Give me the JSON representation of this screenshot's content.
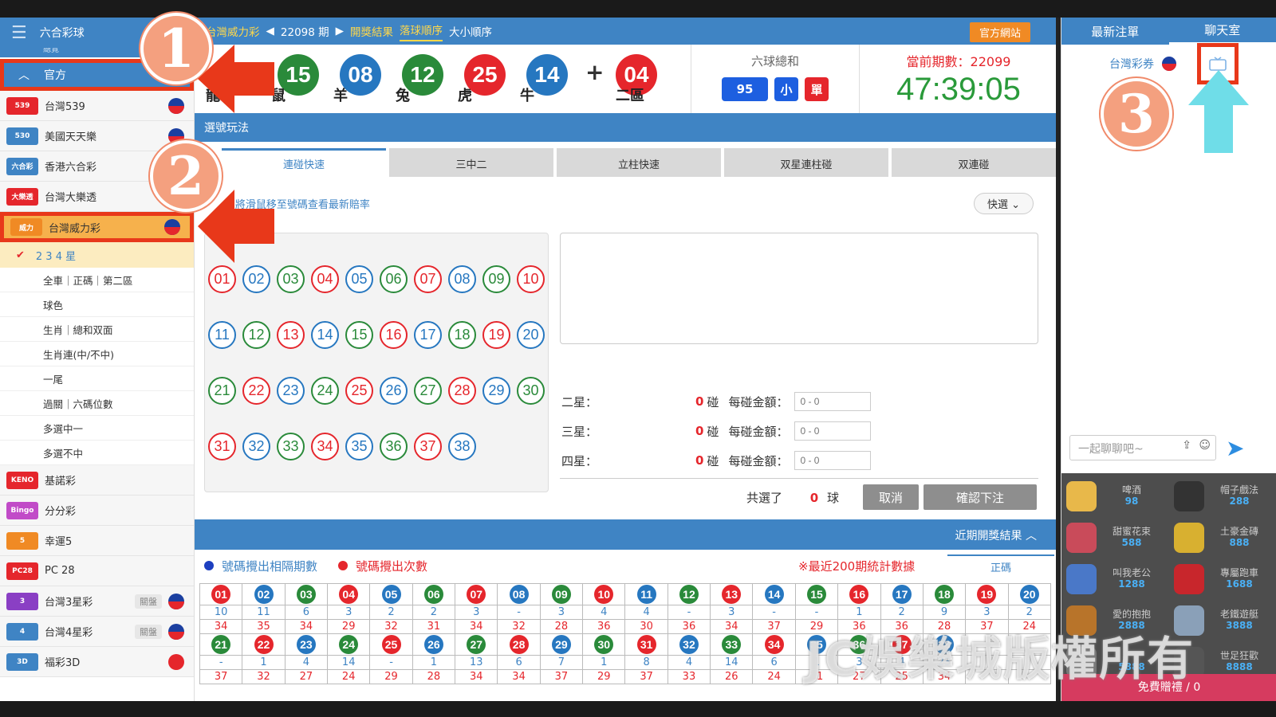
{
  "sidebar": {
    "title": "六合彩球",
    "sub": "總覽",
    "official": "官方",
    "games_top": [
      {
        "name": "台灣539",
        "logo": "539",
        "color": "#e5262c",
        "flag": "tw"
      },
      {
        "name": "美國天天樂",
        "logo": "530",
        "color": "#3f84c4",
        "flag": "tw"
      },
      {
        "name": "香港六合彩",
        "logo": "六合彩",
        "color": "#3f84c4",
        "flag": ""
      },
      {
        "name": "台灣大樂透",
        "logo": "大樂透",
        "color": "#e5262c",
        "flag": ""
      }
    ],
    "active_game": "台灣威力彩",
    "selected_play": "2 3 4 星",
    "sub_items": [
      "全車｜正碼｜第二區",
      "球色",
      "生肖｜總和双面",
      "生肖連(中/不中)",
      "一尾",
      "過關｜六碼位數",
      "多選中一",
      "多選不中"
    ],
    "games_bottom": [
      {
        "name": "基諾彩",
        "logo": "KENO",
        "color": "#e5262c",
        "badge": "",
        "flag": ""
      },
      {
        "name": "分分彩",
        "logo": "Bingo",
        "color": "#c14bc8",
        "badge": "",
        "flag": ""
      },
      {
        "name": "幸運5",
        "logo": "5",
        "color": "#f08a24",
        "badge": "",
        "flag": ""
      },
      {
        "name": "PC 28",
        "logo": "PC28",
        "color": "#e5262c",
        "badge": "",
        "flag": ""
      },
      {
        "name": "台灣3星彩",
        "logo": "3",
        "color": "#8a3fc4",
        "badge": "關盤",
        "flag": "tw"
      },
      {
        "name": "台灣4星彩",
        "logo": "4",
        "color": "#3f84c4",
        "badge": "關盤",
        "flag": "tw"
      },
      {
        "name": "福彩3D",
        "logo": "3D",
        "color": "#3f84c4",
        "badge": "",
        "flag": "cn"
      }
    ]
  },
  "nav": {
    "game": "台灣威力彩",
    "period": "22098 期",
    "results": "開獎結果",
    "drop_order": "落球順序",
    "size_order": "大小順序",
    "official_site": "官方網站"
  },
  "draw": {
    "balls": [
      {
        "num": "15",
        "label": "鼠",
        "color": "#2a8a3a"
      },
      {
        "num": "08",
        "label": "羊",
        "color": "#2677c0"
      },
      {
        "num": "12",
        "label": "兔",
        "color": "#2a8a3a"
      },
      {
        "num": "25",
        "label": "虎",
        "color": "#e5262c"
      },
      {
        "num": "14",
        "label": "牛",
        "color": "#2677c0"
      }
    ],
    "first_label": "龍",
    "special": {
      "num": "04",
      "label": "二區",
      "color": "#e5262c"
    },
    "sum_title": "六球總和",
    "sum_value": "95",
    "sum_size": "小",
    "sum_parity": "單",
    "period_label": "當前期數：22099",
    "countdown": "47:39:05"
  },
  "play": {
    "section_title": "選號玩法",
    "tabs": [
      "連碰快速",
      "三中二",
      "立柱快速",
      "双星連柱碰",
      "双連碰"
    ],
    "hint": "※將滑鼠移至號碼查看最新賠率",
    "quick_select": "快選",
    "numbers": [
      {
        "n": "01",
        "c": "r"
      },
      {
        "n": "02",
        "c": "b"
      },
      {
        "n": "03",
        "c": "g"
      },
      {
        "n": "04",
        "c": "r"
      },
      {
        "n": "05",
        "c": "b"
      },
      {
        "n": "06",
        "c": "g"
      },
      {
        "n": "07",
        "c": "r"
      },
      {
        "n": "08",
        "c": "b"
      },
      {
        "n": "09",
        "c": "g"
      },
      {
        "n": "10",
        "c": "r"
      },
      {
        "n": "11",
        "c": "b"
      },
      {
        "n": "12",
        "c": "g"
      },
      {
        "n": "13",
        "c": "r"
      },
      {
        "n": "14",
        "c": "b"
      },
      {
        "n": "15",
        "c": "g"
      },
      {
        "n": "16",
        "c": "r"
      },
      {
        "n": "17",
        "c": "b"
      },
      {
        "n": "18",
        "c": "g"
      },
      {
        "n": "19",
        "c": "r"
      },
      {
        "n": "20",
        "c": "b"
      },
      {
        "n": "21",
        "c": "g"
      },
      {
        "n": "22",
        "c": "r"
      },
      {
        "n": "23",
        "c": "b"
      },
      {
        "n": "24",
        "c": "g"
      },
      {
        "n": "25",
        "c": "r"
      },
      {
        "n": "26",
        "c": "b"
      },
      {
        "n": "27",
        "c": "g"
      },
      {
        "n": "28",
        "c": "r"
      },
      {
        "n": "29",
        "c": "b"
      },
      {
        "n": "30",
        "c": "g"
      },
      {
        "n": "31",
        "c": "r"
      },
      {
        "n": "32",
        "c": "b"
      },
      {
        "n": "33",
        "c": "g"
      },
      {
        "n": "34",
        "c": "r"
      },
      {
        "n": "35",
        "c": "b"
      },
      {
        "n": "36",
        "c": "g"
      },
      {
        "n": "37",
        "c": "r"
      },
      {
        "n": "38",
        "c": "b"
      }
    ],
    "bets": [
      {
        "label": "二星：",
        "count": "0",
        "unit": "碰",
        "amount_label": "每碰金額：",
        "placeholder": "0 - 0"
      },
      {
        "label": "三星：",
        "count": "0",
        "unit": "碰",
        "amount_label": "每碰金額：",
        "placeholder": "0 - 0"
      },
      {
        "label": "四星：",
        "count": "0",
        "unit": "碰",
        "amount_label": "每碰金額：",
        "placeholder": "0 - 0"
      }
    ],
    "selected_prefix": "共選了",
    "selected_count": "0",
    "selected_unit": "球",
    "cancel": "取消",
    "confirm": "確認下注"
  },
  "recent": {
    "title": "近期開獎結果",
    "legend_blue": "號碼攪出相隔期數",
    "legend_red": "號碼攪出次數",
    "note": "※最近200期統計數據",
    "tab": "正碼",
    "rows": [
      {
        "balls": [
          [
            "01",
            "r"
          ],
          [
            "02",
            "b"
          ],
          [
            "03",
            "g"
          ],
          [
            "04",
            "r"
          ],
          [
            "05",
            "b"
          ],
          [
            "06",
            "g"
          ],
          [
            "07",
            "r"
          ],
          [
            "08",
            "b"
          ],
          [
            "09",
            "g"
          ],
          [
            "10",
            "r"
          ],
          [
            "11",
            "b"
          ],
          [
            "12",
            "g"
          ],
          [
            "13",
            "r"
          ],
          [
            "14",
            "b"
          ],
          [
            "15",
            "g"
          ],
          [
            "16",
            "r"
          ],
          [
            "17",
            "b"
          ],
          [
            "18",
            "g"
          ],
          [
            "19",
            "r"
          ],
          [
            "20",
            "b"
          ]
        ],
        "gap": [
          "10",
          "11",
          "6",
          "3",
          "2",
          "2",
          "3",
          "-",
          "3",
          "4",
          "4",
          "-",
          "3",
          "-",
          "-",
          "1",
          "2",
          "9",
          "3",
          "2"
        ],
        "count": [
          "34",
          "35",
          "34",
          "29",
          "32",
          "31",
          "34",
          "32",
          "28",
          "36",
          "30",
          "36",
          "34",
          "37",
          "29",
          "36",
          "36",
          "28",
          "37",
          "24"
        ]
      },
      {
        "balls": [
          [
            "21",
            "g"
          ],
          [
            "22",
            "r"
          ],
          [
            "23",
            "b"
          ],
          [
            "24",
            "g"
          ],
          [
            "25",
            "r"
          ],
          [
            "26",
            "b"
          ],
          [
            "27",
            "g"
          ],
          [
            "28",
            "r"
          ],
          [
            "29",
            "b"
          ],
          [
            "30",
            "g"
          ],
          [
            "31",
            "r"
          ],
          [
            "32",
            "b"
          ],
          [
            "33",
            "g"
          ],
          [
            "34",
            "r"
          ],
          [
            "35",
            "b"
          ],
          [
            "36",
            "g"
          ],
          [
            "37",
            "r"
          ],
          [
            "38",
            "b"
          ]
        ],
        "gap": [
          "-",
          "1",
          "4",
          "14",
          "-",
          "1",
          "13",
          "6",
          "7",
          "1",
          "8",
          "4",
          "14",
          "6",
          "1",
          "3",
          "4",
          "23"
        ],
        "count": [
          "37",
          "32",
          "27",
          "24",
          "29",
          "28",
          "34",
          "34",
          "37",
          "29",
          "37",
          "33",
          "26",
          "24",
          "31",
          "27",
          "25",
          "34"
        ]
      }
    ]
  },
  "chat": {
    "tabs": [
      "最新注單",
      "聊天室"
    ],
    "room": "台灣彩券",
    "placeholder": "一起聊聊吧~",
    "gifts": [
      {
        "name": "啤酒",
        "price": "98"
      },
      {
        "name": "帽子戲法",
        "price": "288"
      },
      {
        "name": "甜蜜花束",
        "price": "588"
      },
      {
        "name": "土豪金磚",
        "price": "888"
      },
      {
        "name": "叫我老公",
        "price": "1288"
      },
      {
        "name": "專屬跑車",
        "price": "1688"
      },
      {
        "name": "愛的抱抱",
        "price": "2888"
      },
      {
        "name": "老鐵遊艇",
        "price": "3888"
      },
      {
        "name": "",
        "price": "5888"
      },
      {
        "name": "世足狂歡",
        "price": "8888"
      }
    ],
    "free_gift": "免費贈禮 / 0"
  },
  "annotations": {
    "one": "1",
    "two": "2",
    "three": "3"
  },
  "watermark": "JC娛樂城版權所有",
  "colors": {
    "r": "#e5262c",
    "b": "#2677c0",
    "g": "#2a8a3a",
    "accent": "#3f84c4",
    "highlight": "#e8381a"
  }
}
